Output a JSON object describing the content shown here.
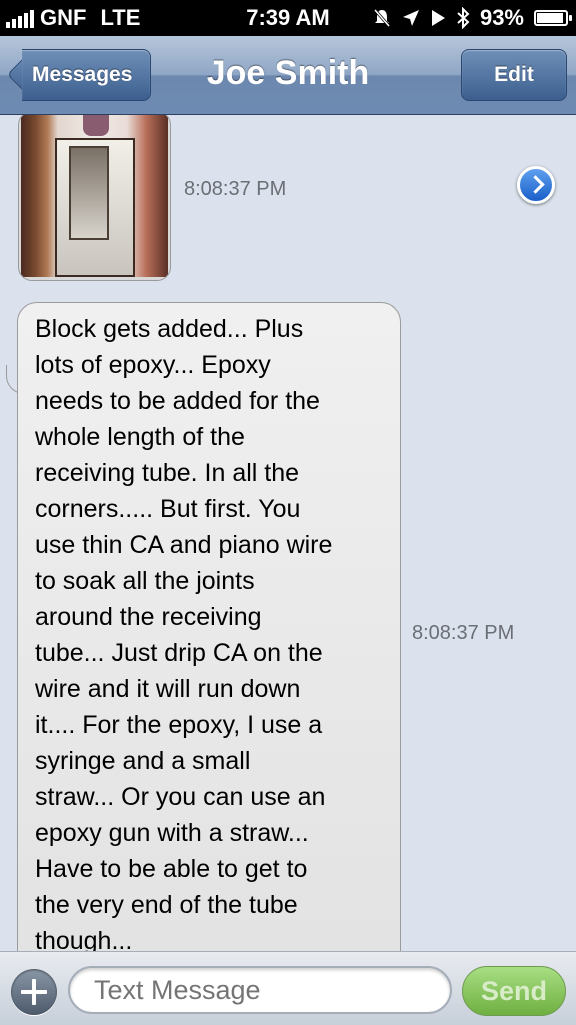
{
  "status_bar": {
    "carrier": "GNF",
    "network": "LTE",
    "time": "7:39 AM",
    "battery": "93%",
    "battery_level": 0.93,
    "icons": [
      "signal-bars-icon",
      "alarm-muted-icon",
      "location-arrow-icon",
      "play-icon",
      "bluetooth-icon",
      "battery-icon"
    ]
  },
  "nav": {
    "back_label": "Messages",
    "title": "Joe Smith",
    "edit_label": "Edit"
  },
  "messages": [
    {
      "type": "photo",
      "timestamp": "8:08:37 PM",
      "detail_icon": "chevron-right-circle-icon"
    },
    {
      "type": "text",
      "timestamp": "8:08:37 PM",
      "lines": [
        "Block gets added... Plus",
        "lots of epoxy... Epoxy",
        "needs to be added for the",
        "whole length of the",
        "receiving tube.  In all the",
        "corners..... But first.  You",
        "use thin CA and piano wire",
        "to soak all the joints",
        "around the receiving",
        "tube... Just drip CA on the",
        "wire and it will run down",
        "it.... For the epoxy,  I use a",
        "syringe and a small",
        "straw... Or you can use an",
        "epoxy gun with a straw...",
        "Have to be able to get to",
        "the very end of the tube",
        "though..."
      ]
    }
  ],
  "compose": {
    "placeholder": "Text Message",
    "send_label": "Send"
  },
  "colors": {
    "background": "#dbe2ed",
    "send_green": "#7dbd4f",
    "nav_blue": "#6d8bb3"
  }
}
